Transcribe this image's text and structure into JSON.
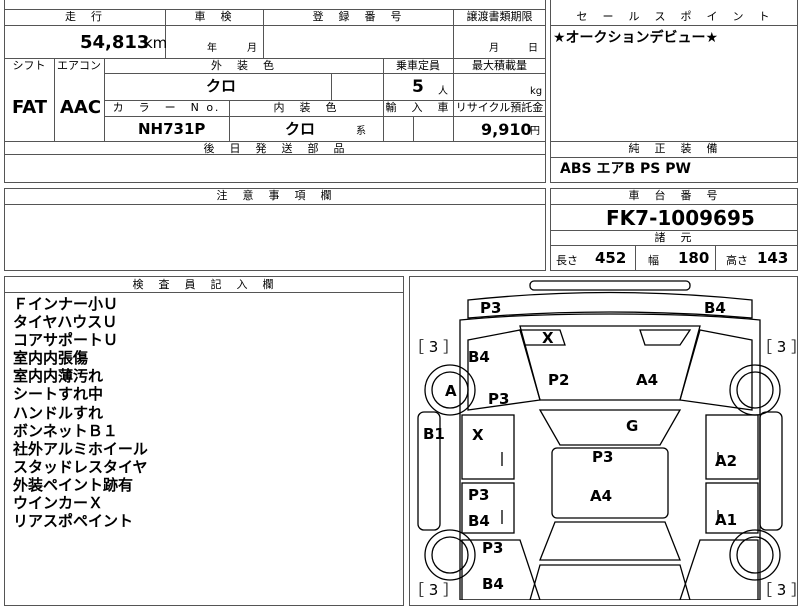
{
  "vehicle": {
    "labels": {
      "mileage": "走　行",
      "inspection": "車　検",
      "registration": "登　録　番　号",
      "transfer_deadline": "譲渡書類期限",
      "shift": "シフト",
      "aircon": "エアコン",
      "exterior_color": "外　装　色",
      "capacity": "乗車定員",
      "max_load": "最大積載量",
      "color_no": "カ　ラ　ー　N o.",
      "interior_color": "内　装　色",
      "import": "輸　入　車",
      "recycle_fee": "リサイクル預託金",
      "later_parts": "後　日　発　送　部　品"
    },
    "mileage": "54,813",
    "mileage_unit": "km",
    "inspection_year": "年",
    "inspection_month": "月",
    "deadline_month": "月",
    "deadline_day": "日",
    "shift": "FAT",
    "aircon": "AAC",
    "exterior_color": "クロ",
    "capacity": "5",
    "capacity_unit": "人",
    "load_unit": "kg",
    "color_no": "NH731P",
    "interior_color": "クロ",
    "interior_suffix": "系",
    "recycle_fee": "9,910",
    "recycle_unit": "円"
  },
  "sales_point": {
    "title": "セ　ー　ル　ス　ポ　イ　ン　ト",
    "text": "★オークションデビュー★"
  },
  "equipment": {
    "title": "純　正　装　備",
    "text": "ABS エアB PS PW"
  },
  "caution": {
    "title": "注　意　事　項　欄"
  },
  "chassis": {
    "title": "車　台　番　号",
    "number": "FK7-1009695"
  },
  "specs": {
    "title": "諸　元",
    "length_label": "長さ",
    "length": "452",
    "width_label": "幅",
    "width": "180",
    "height_label": "高さ",
    "height": "143"
  },
  "inspector": {
    "title": "検　査　員　記　入　欄",
    "notes": [
      "Ｆインナー小Ｕ",
      "タイヤハウスＵ",
      "コアサポートＵ",
      "室内内張傷",
      "室内内薄汚れ",
      "シートすれ中",
      "ハンドルすれ",
      "ボンネットＢ１",
      "社外アルミホイール",
      "スタッドレスタイヤ",
      "外装ペイント跡有",
      "ウインカーＸ",
      "リアスポペイント"
    ]
  },
  "diagram": {
    "tire_tread": "［ 3 ］",
    "codes": {
      "front_bumper_left": "P3",
      "front_bumper_right": "B4",
      "fender_left_top": "B4",
      "hood_left": "X",
      "wheel_front_left": "A",
      "fender_left": "P3",
      "hood": "P2",
      "hood_right": "A4",
      "windshield": "G",
      "door_left_sill": "B1",
      "front_door_left": "X",
      "roof": "P3",
      "front_door_right": "A2",
      "rear_door_left_upper": "P3",
      "roof_rear": "A4",
      "rear_door_left": "B4",
      "rear_door_right": "A1",
      "quarter_left": "P3",
      "quarter_left_low": "B4"
    }
  }
}
